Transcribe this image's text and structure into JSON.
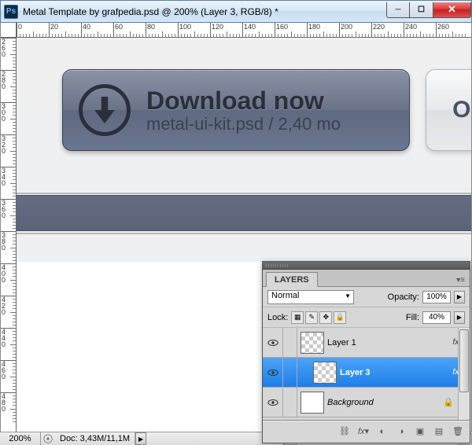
{
  "titlebar": {
    "app_icon": "Ps",
    "title": "Metal Template by grafpedia.psd @ 200% (Layer 3, RGB/8) *"
  },
  "ruler_h": [
    0,
    20,
    40,
    60,
    80,
    100,
    120,
    140,
    160,
    180,
    200,
    220,
    240,
    260
  ],
  "ruler_v": [
    260,
    280,
    300,
    320,
    340,
    360,
    380,
    400,
    420,
    440,
    460,
    480
  ],
  "canvas": {
    "download_btn": {
      "title": "Download now",
      "subtitle": "metal-ui-kit.psd / 2,40 mo"
    },
    "btn2_text": "OI"
  },
  "status": {
    "zoom": "200%",
    "doc": "Doc: 3,43M/11,1M"
  },
  "layers_panel": {
    "tab": "LAYERS",
    "blend_mode": "Normal",
    "opacity_label": "Opacity:",
    "opacity_value": "100%",
    "lock_label": "Lock:",
    "fill_label": "Fill:",
    "fill_value": "40%",
    "layers": [
      {
        "name": "Layer 1",
        "fx": true,
        "thumb": "checker"
      },
      {
        "name": "Layer 3",
        "fx": true,
        "thumb": "checker",
        "selected": true
      },
      {
        "name": "Background",
        "locked": true,
        "thumb": "white",
        "italic": true
      }
    ]
  }
}
